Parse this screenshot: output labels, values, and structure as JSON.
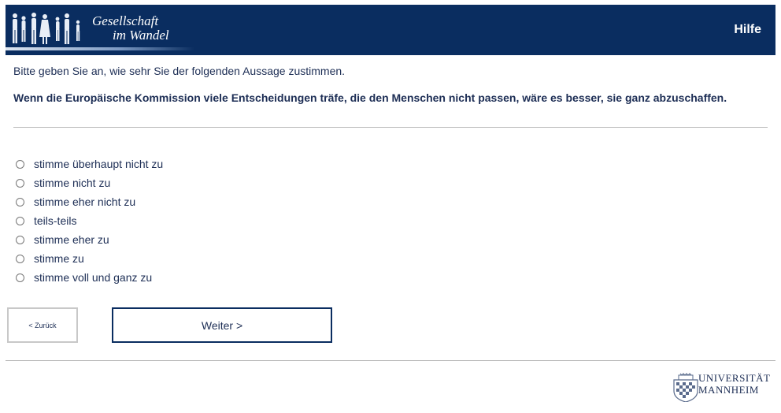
{
  "header": {
    "logo_line1": "Gesellschaft",
    "logo_line2": "im Wandel",
    "help_label": "Hilfe"
  },
  "survey": {
    "instruction": "Bitte geben Sie an, wie sehr Sie der folgenden Aussage zustimmen.",
    "question": "Wenn die Europäische Kommission viele Entscheidungen träfe, die den Menschen nicht passen, wäre es besser, sie ganz abzuschaffen.",
    "options": [
      "stimme überhaupt nicht zu",
      "stimme nicht zu",
      "stimme eher nicht zu",
      "teils-teils",
      "stimme eher zu",
      "stimme zu",
      "stimme voll und ganz zu"
    ]
  },
  "nav": {
    "back_label": "< Zurück",
    "next_label": "Weiter >"
  },
  "footer": {
    "uni_line1": "UNIVERSITÄT",
    "uni_line2": "MANNHEIM"
  },
  "colors": {
    "header_bg": "#0a2d60",
    "text": "#1d2e55"
  }
}
